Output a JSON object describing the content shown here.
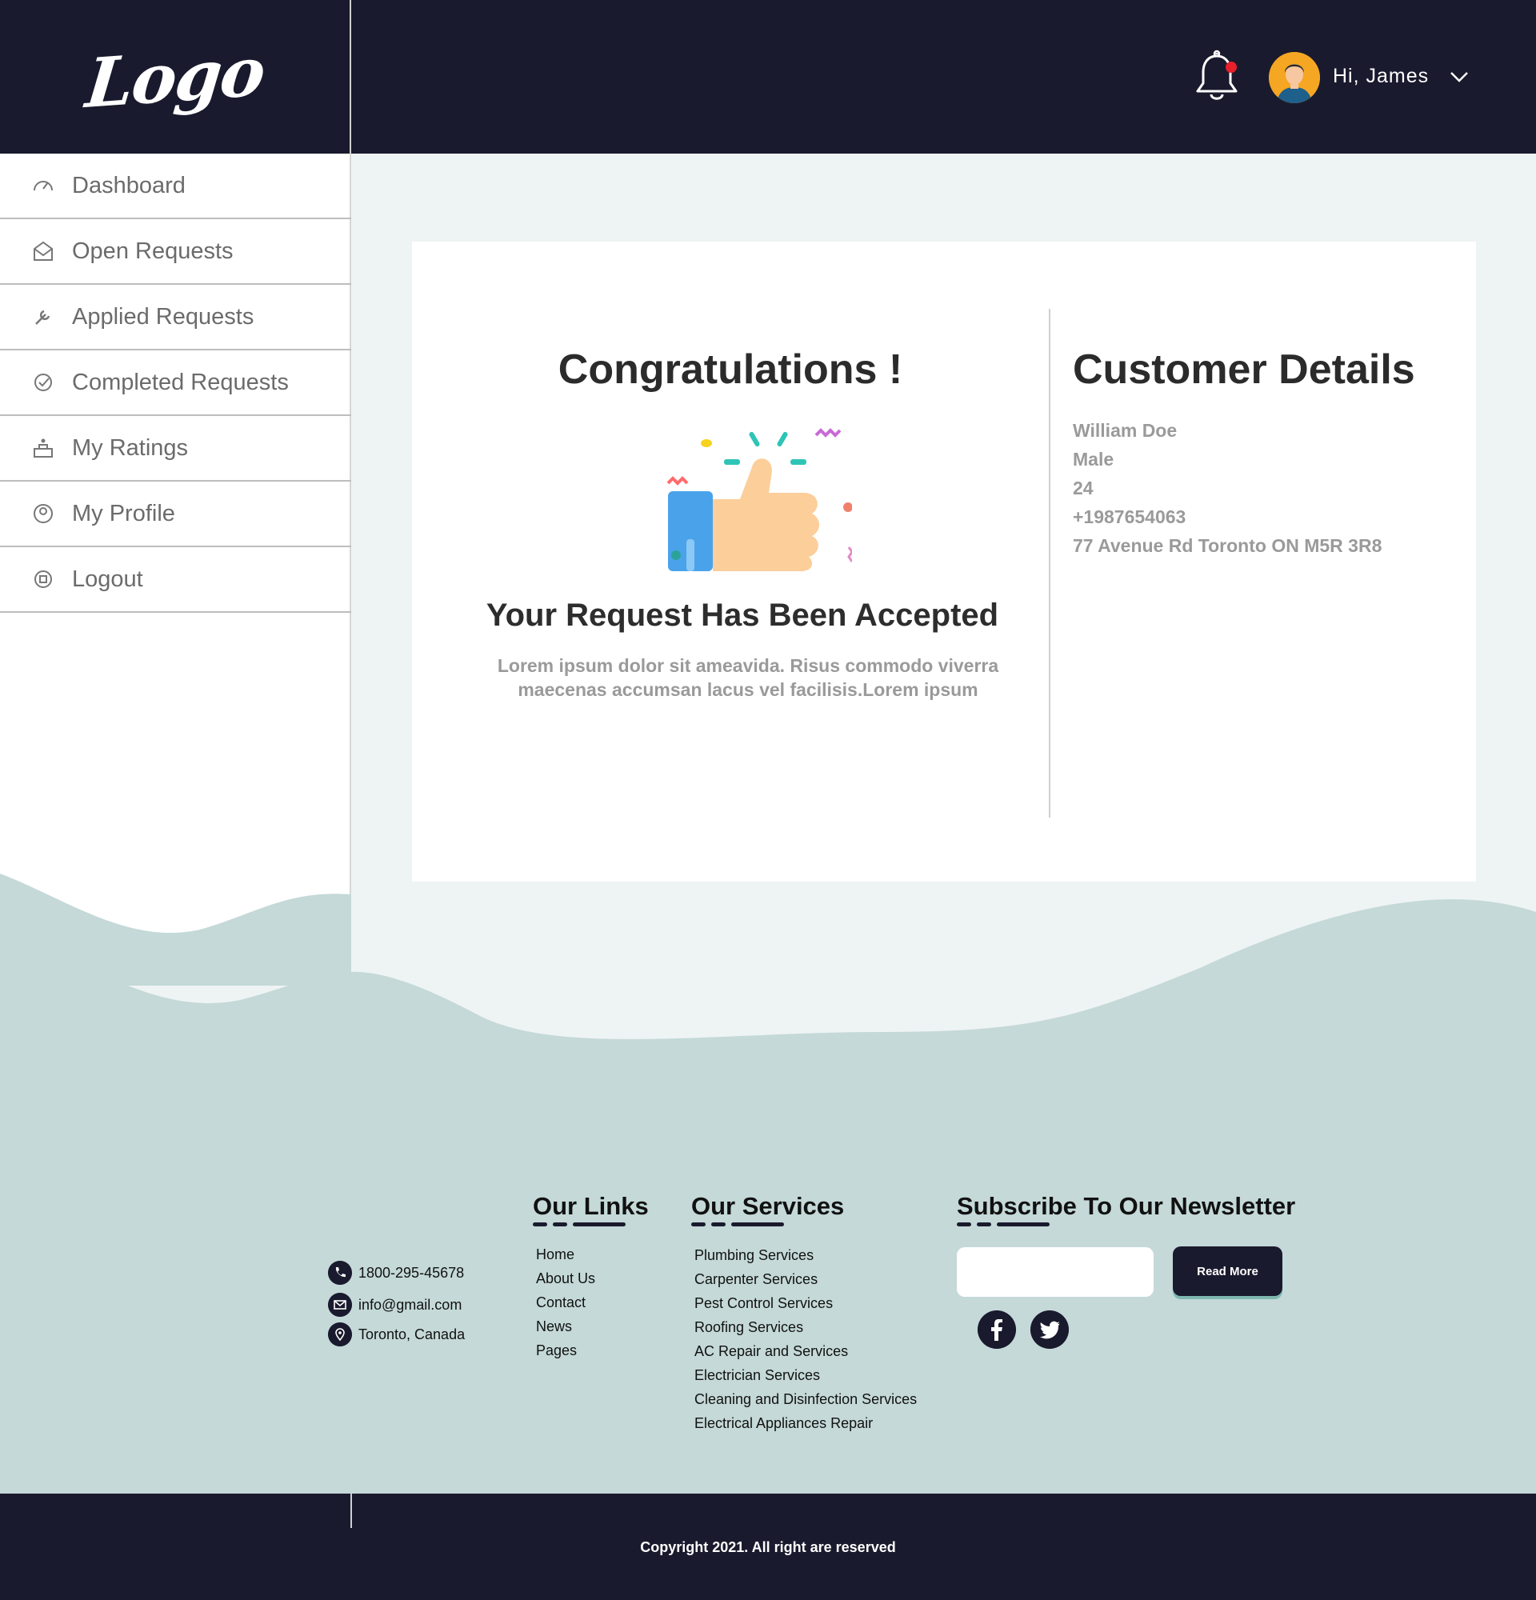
{
  "header": {
    "logo": "Logo",
    "greeting": "Hi, James"
  },
  "sidebar": {
    "items": [
      {
        "label": "Dashboard",
        "icon": "speedometer-icon"
      },
      {
        "label": "Open Requests",
        "icon": "open-envelope-icon"
      },
      {
        "label": "Applied Requests",
        "icon": "wrench-icon"
      },
      {
        "label": "Completed Requests",
        "icon": "check-circle-icon"
      },
      {
        "label": "My Ratings",
        "icon": "podium-star-icon"
      },
      {
        "label": "My Profile",
        "icon": "user-circle-icon"
      },
      {
        "label": "Logout",
        "icon": "logout-circle-icon"
      }
    ]
  },
  "main": {
    "title": "Congratulations !",
    "subtitle": "Your Request Has Been Accepted",
    "description": "Lorem ipsum dolor sit ameavida. Risus commodo viverra maecenas accumsan lacus vel facilisis.Lorem ipsum"
  },
  "customer": {
    "title": "Customer Details",
    "name": "William Doe",
    "gender": "Male",
    "age": "24",
    "phone": "+1987654063",
    "address": "77 Avenue Rd Toronto ON M5R 3R8"
  },
  "footer": {
    "contact": {
      "phone": "1800-295-45678",
      "email": "info@gmail.com",
      "location": "Toronto, Canada"
    },
    "links_title": "Our Links",
    "links": [
      "Home",
      "About Us",
      "Contact",
      "News",
      "Pages"
    ],
    "services_title": "Our Services",
    "services": [
      "Plumbing Services",
      "Carpenter Services",
      "Pest Control Services",
      "Roofing Services",
      "AC Repair and Services",
      "Electrician Services",
      "Cleaning and Disinfection Services",
      "Electrical Appliances Repair"
    ],
    "newsletter_title": "Subscribe To Our Newsletter",
    "newsletter_button": "Read More",
    "copyright": "Copyright 2021. All right are reserved"
  },
  "colors": {
    "navy": "#1a1a2e",
    "page_bg": "#eef3f3",
    "wave": "#c4d9d8",
    "muted_text": "#9a9a9a"
  }
}
